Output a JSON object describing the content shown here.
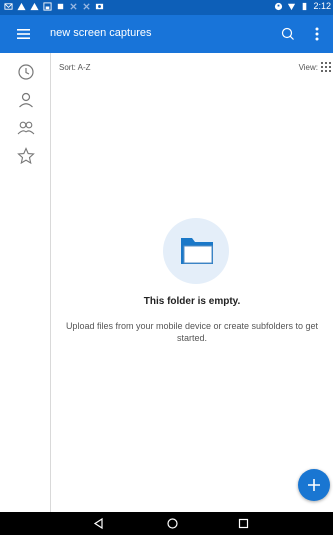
{
  "status_bar": {
    "time": "2:12",
    "left_icons": [
      "mail-icon",
      "warning-icon",
      "warning-icon",
      "sim-icon",
      "square-icon",
      "crossed-icon",
      "crossed-icon",
      "photo-icon"
    ],
    "right_icons": [
      "wifi-icon",
      "signal-icon",
      "battery-icon"
    ]
  },
  "app_bar": {
    "title": "new screen captures"
  },
  "sidebar": {
    "items": [
      "recent-icon",
      "person-icon",
      "people-icon",
      "star-icon"
    ]
  },
  "toolbar": {
    "sort_label": "Sort: A-Z",
    "view_label": "View:"
  },
  "empty_state": {
    "title": "This folder is empty.",
    "subtitle": "Upload files from your mobile device or create subfolders to get started."
  },
  "colors": {
    "status_bar": "#0d5fb8",
    "app_bar": "#1874d9",
    "fab": "#1976d2",
    "illus_bg": "#e4eef9"
  }
}
